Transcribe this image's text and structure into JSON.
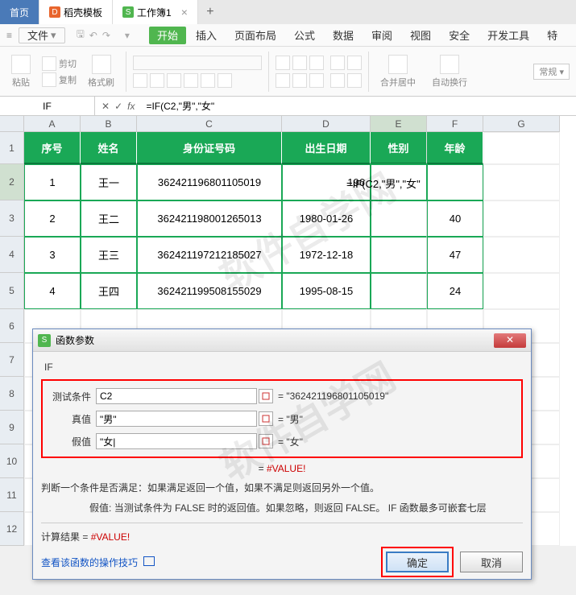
{
  "tabs": {
    "home": "首页",
    "template": "稻壳模板",
    "workbook": "工作簿1"
  },
  "menu": {
    "file": "文件",
    "start": "开始",
    "insert": "插入",
    "layout": "页面布局",
    "formula": "公式",
    "data": "数据",
    "review": "审阅",
    "view": "视图",
    "security": "安全",
    "devtools": "开发工具",
    "extra": "特"
  },
  "ribbon": {
    "paste": "粘贴",
    "copy_icon": "复制",
    "format_painter": "格式刷",
    "merge": "合并居中",
    "wrap": "自动换行",
    "viewmode": "常规"
  },
  "formulabar": {
    "name": "IF",
    "fx": "fx",
    "value": "=IF(C2,\"男\",\"女\""
  },
  "cols": [
    "A",
    "B",
    "C",
    "D",
    "E",
    "F",
    "G"
  ],
  "header": {
    "A": "序号",
    "B": "姓名",
    "C": "身份证号码",
    "D": "出生日期",
    "E": "性别",
    "F": "年龄"
  },
  "rows": [
    {
      "n": "1",
      "A": "1",
      "B": "王一",
      "C": "362421196801105019",
      "D": "196",
      "E": "",
      "F": ""
    },
    {
      "n": "2",
      "A": "2",
      "B": "王二",
      "C": "362421198001265013",
      "D": "1980-01-26",
      "E": "",
      "F": "40"
    },
    {
      "n": "3",
      "A": "3",
      "B": "王三",
      "C": "362421197212185027",
      "D": "1972-12-18",
      "E": "",
      "F": "47"
    },
    {
      "n": "4",
      "A": "4",
      "B": "王四",
      "C": "362421199508155029",
      "D": "1995-08-15",
      "E": "",
      "F": "24"
    }
  ],
  "overflow_formula": "=IF(C2,\"男\",\"女\"",
  "dialog": {
    "title": "函数参数",
    "fn": "IF",
    "args": {
      "test_label": "测试条件",
      "test_value": "C2",
      "test_result": "= \"362421196801105019\"",
      "true_label": "真值",
      "true_value": "\"男\"",
      "true_result": "= \"男\"",
      "false_label": "假值",
      "false_value": "\"女|",
      "false_result": "= \"女\""
    },
    "eval_prefix": "= ",
    "eval_result": "#VALUE!",
    "desc1": "判断一个条件是否满足：如果满足返回一个值，如果不满足则返回另外一个值。",
    "desc2_label": "假值:",
    "desc2": "当测试条件为 FALSE 时的返回值。如果忽略，则返回 FALSE。 IF 函数最多可嵌套七层",
    "calc_label": "计算结果 = ",
    "calc_value": "#VALUE!",
    "help_link": "查看该函数的操作技巧",
    "ok": "确定",
    "cancel": "取消"
  },
  "watermark": "软件自学网"
}
